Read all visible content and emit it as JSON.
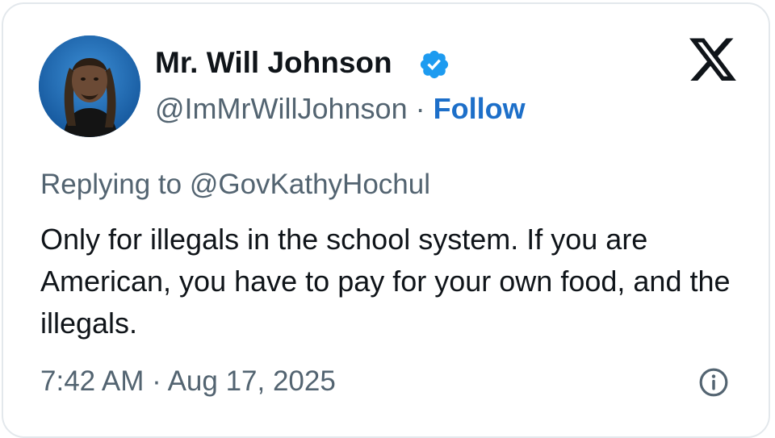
{
  "author": {
    "display_name": "Mr. Will Johnson",
    "handle": "@ImMrWillJohnson",
    "separator": " · ",
    "follow_label": "Follow",
    "avatar_icon": "avatar-photo",
    "verified_icon": "verified-badge-icon"
  },
  "platform": {
    "logo_icon": "x-logo-icon"
  },
  "tweet": {
    "replying_prefix": "Replying to ",
    "replying_to": "@GovKathyHochul",
    "text": "Only for illegals in the school system. If you are American, you have to pay for your own food, and the illegals.",
    "timestamp": "7:42 AM · Aug 17, 2025",
    "info_icon": "info-icon"
  },
  "colors": {
    "accent": "#1d9bf0",
    "follow": "#1d6fc9",
    "text_primary": "#0f1419",
    "text_secondary": "#536471",
    "border": "#e3e8ec"
  }
}
